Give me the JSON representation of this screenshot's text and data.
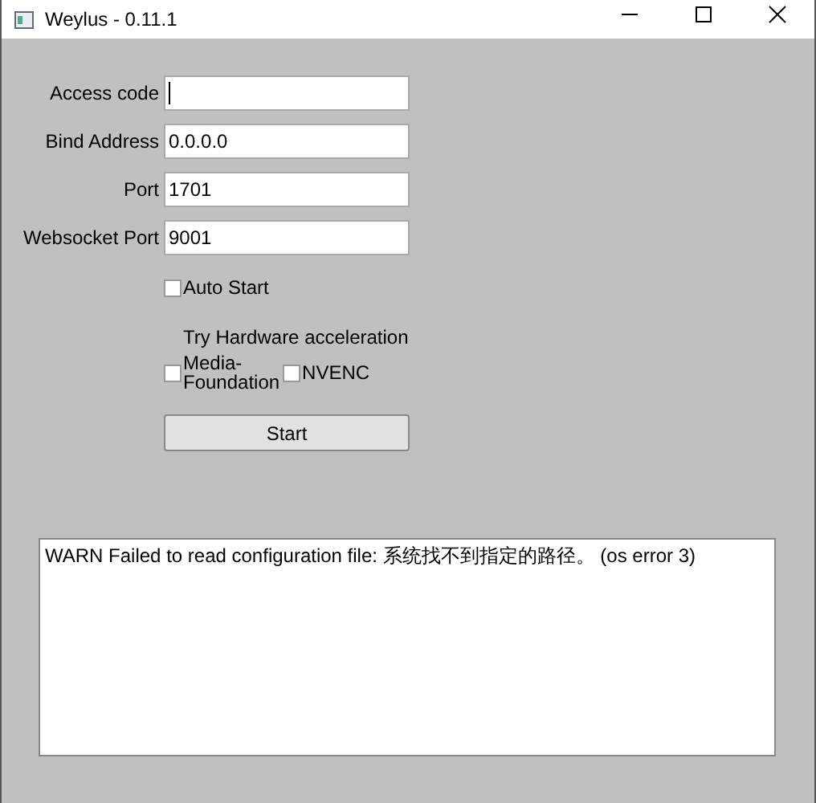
{
  "window": {
    "title": "Weylus - 0.11.1"
  },
  "fields": [
    {
      "label": "Access code"
    },
    {
      "label": "Bind Address",
      "value": "0.0.0.0"
    },
    {
      "label": "Port",
      "value": "1701"
    },
    {
      "label": "Websocket Port",
      "value": "9001"
    }
  ],
  "auto_start": {
    "label": "Auto Start",
    "checked": false
  },
  "hardware_acceleration": {
    "heading": "Try Hardware acceleration",
    "options": [
      {
        "label": "Media-\nFoundation",
        "checked": false
      },
      {
        "label": "NVENC",
        "checked": false
      }
    ]
  },
  "start_button": "Start",
  "log": "WARN Failed to read configuration file: 系统找不到指定的路径。 (os error 3)"
}
